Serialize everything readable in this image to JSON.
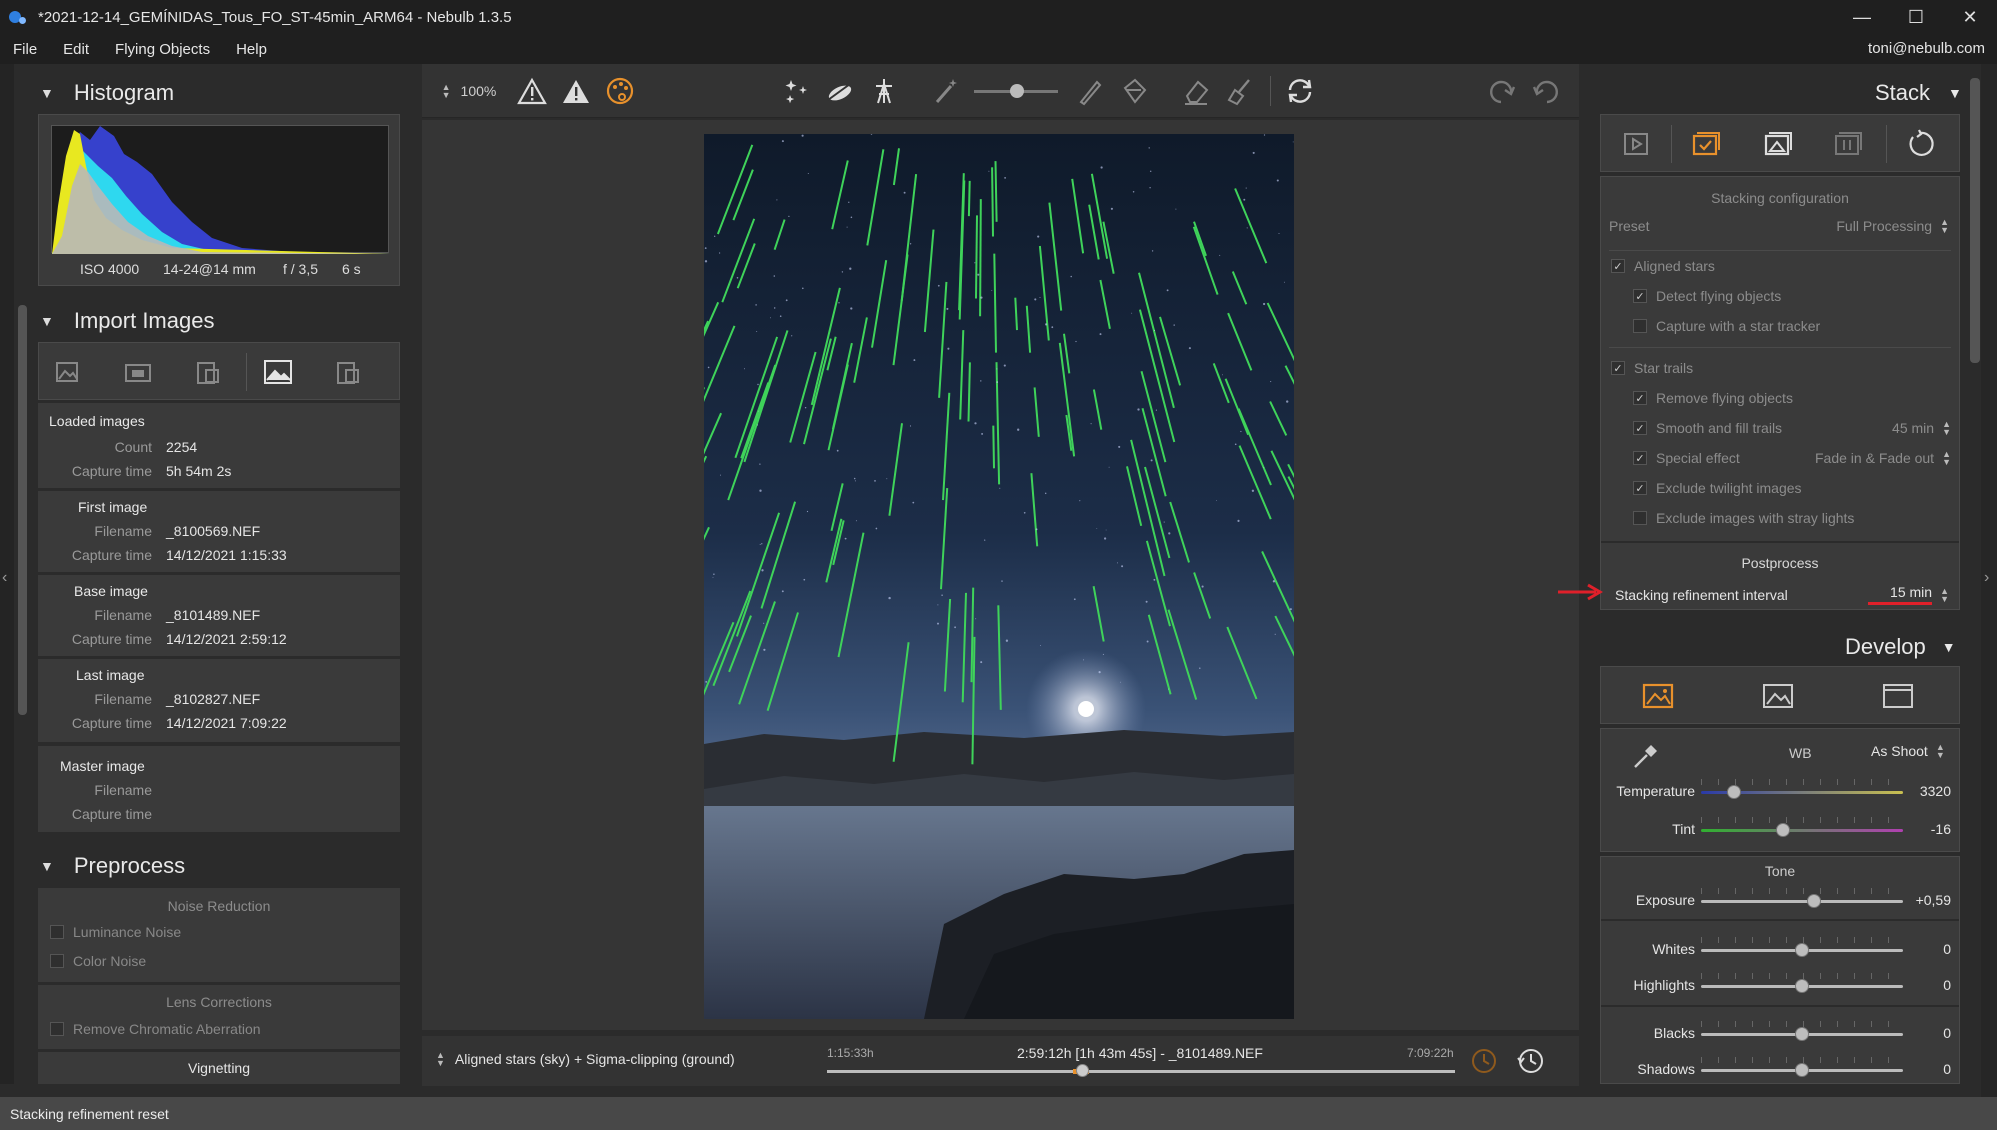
{
  "window": {
    "title": "*2021-12-14_GEMÍNIDAS_Tous_FO_ST-45min_ARM64 - Nebulb 1.3.5",
    "minimize": "—",
    "maximize": "☐",
    "close": "✕"
  },
  "menu": {
    "items": [
      "File",
      "Edit",
      "Flying Objects",
      "Help"
    ],
    "account": "toni@nebulb.com"
  },
  "histogram": {
    "title": "Histogram",
    "iso": "ISO 4000",
    "lens": "14-24@14 mm",
    "aperture": "f / 3,5",
    "shutter": "6 s"
  },
  "import": {
    "title": "Import Images",
    "loaded": {
      "title": "Loaded images",
      "count_label": "Count",
      "count": "2254",
      "capture_label": "Capture time",
      "capture": "5h 54m 2s"
    },
    "first": {
      "title": "First image",
      "filename_label": "Filename",
      "filename": "_8100569.NEF",
      "capture_label": "Capture time",
      "capture": "14/12/2021 1:15:33"
    },
    "base": {
      "title": "Base image",
      "filename_label": "Filename",
      "filename": "_8101489.NEF",
      "capture_label": "Capture time",
      "capture": "14/12/2021 2:59:12"
    },
    "last": {
      "title": "Last image",
      "filename_label": "Filename",
      "filename": "_8102827.NEF",
      "capture_label": "Capture time",
      "capture": "14/12/2021 7:09:22"
    },
    "master": {
      "title": "Master image",
      "filename_label": "Filename",
      "capture_label": "Capture time"
    }
  },
  "preprocess": {
    "title": "Preprocess",
    "noise_title": "Noise Reduction",
    "luminance": "Luminance Noise",
    "color": "Color Noise",
    "lens_title": "Lens Corrections",
    "chromatic": "Remove Chromatic Aberration",
    "vignetting": "Vignetting"
  },
  "toolbar": {
    "zoom": "100%"
  },
  "bottom": {
    "mode": "Aligned stars (sky) + Sigma-clipping (ground)",
    "start": "1:15:33h",
    "current": "2:59:12h [1h 43m 45s] - _8101489.NEF",
    "end": "7:09:22h"
  },
  "stack": {
    "title": "Stack",
    "config_title": "Stacking configuration",
    "preset_label": "Preset",
    "preset_value": "Full Processing",
    "aligned_stars": "Aligned stars",
    "detect_flying": "Detect flying objects",
    "star_tracker": "Capture with a star tracker",
    "star_trails": "Star trails",
    "remove_flying": "Remove flying objects",
    "smooth_fill": "Smooth and fill trails",
    "smooth_value": "45 min",
    "special_effect": "Special effect",
    "special_value": "Fade in & Fade out",
    "exclude_twilight": "Exclude twilight images",
    "exclude_stray": "Exclude images with stray lights",
    "postprocess_title": "Postprocess",
    "refinement_label": "Stacking refinement interval",
    "refinement_value": "15 min"
  },
  "develop": {
    "title": "Develop",
    "wb_label": "WB",
    "wb_value": "As Shoot",
    "temperature_label": "Temperature",
    "temperature": "3320",
    "tint_label": "Tint",
    "tint": "-16",
    "tone_title": "Tone",
    "exposure_label": "Exposure",
    "exposure": "+0,59",
    "whites_label": "Whites",
    "whites": "0",
    "highlights_label": "Highlights",
    "highlights": "0",
    "blacks_label": "Blacks",
    "blacks": "0",
    "shadows_label": "Shadows",
    "shadows": "0"
  },
  "status": {
    "message": "Stacking refinement reset"
  },
  "colors": {
    "accent": "#e8912c",
    "trail": "#3fd35a",
    "marker": "#e0202a"
  }
}
